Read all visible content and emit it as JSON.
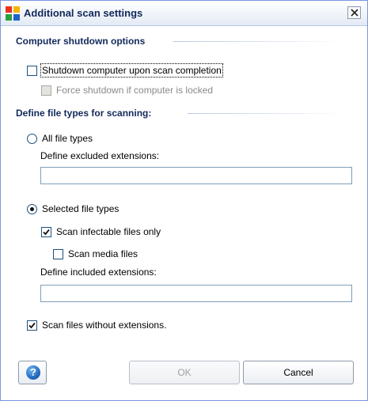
{
  "window": {
    "title": "Additional scan settings"
  },
  "shutdown": {
    "section_title": "Computer shutdown options",
    "shutdown_on_completion": {
      "label": "Shutdown computer upon scan completion",
      "checked": false
    },
    "force_shutdown": {
      "label": "Force shutdown if computer is locked",
      "checked": false,
      "enabled": false
    }
  },
  "file_types": {
    "section_title": "Define file types for scanning:",
    "all_file_types": {
      "label": "All file types",
      "selected": false
    },
    "excluded_label": "Define excluded extensions:",
    "excluded_value": "",
    "selected_file_types": {
      "label": "Selected file types",
      "selected": true
    },
    "scan_infectable": {
      "label": "Scan infectable files only",
      "checked": true
    },
    "scan_media": {
      "label": "Scan media files",
      "checked": false
    },
    "included_label": "Define included extensions:",
    "included_value": "",
    "scan_no_ext": {
      "label": "Scan files without extensions.",
      "checked": true
    }
  },
  "buttons": {
    "help_glyph": "?",
    "ok_label": "OK",
    "cancel_label": "Cancel"
  },
  "colors": {
    "title_text": "#13295a",
    "section_title": "#13295a",
    "help_blue": "#1b5fb8"
  },
  "icons": {
    "app": "avg-app-icon",
    "close": "close-icon",
    "help": "help-icon"
  }
}
